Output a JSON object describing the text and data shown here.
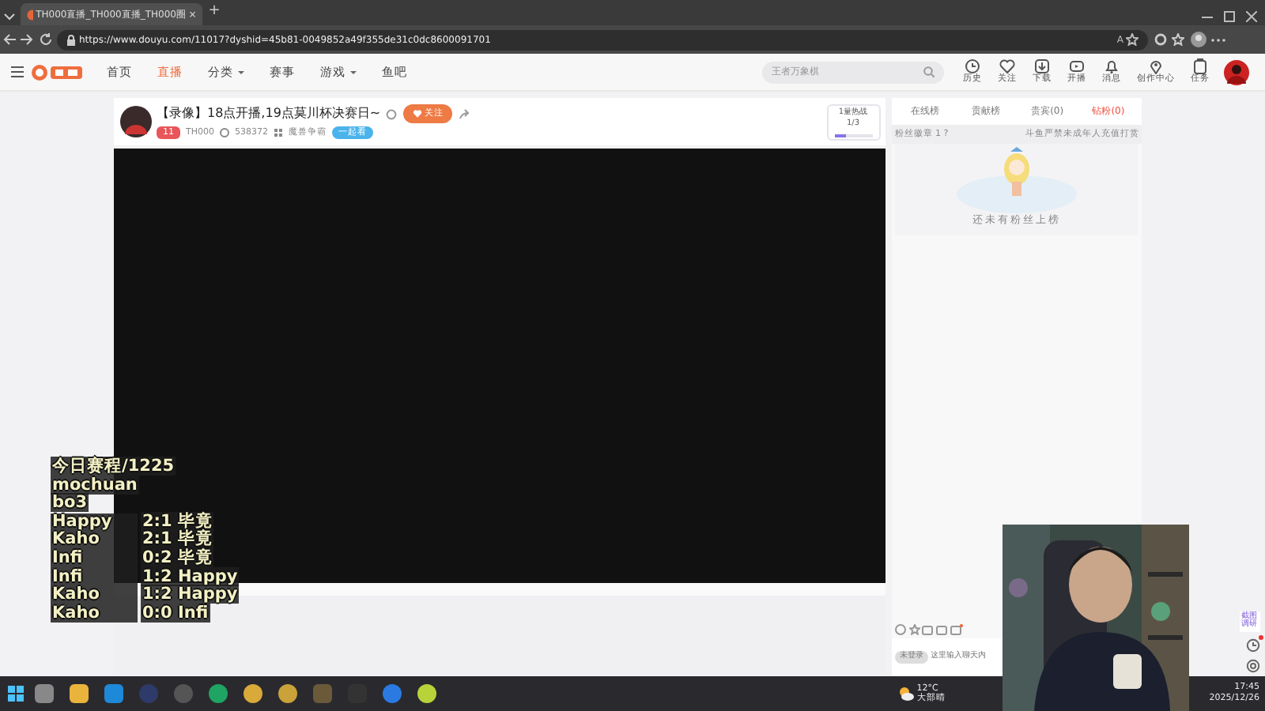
{
  "browser": {
    "tab": {
      "title": "TH000直播_TH000直播_TH000圈",
      "close": "×"
    },
    "new_tab": "+",
    "url": "https://www.douyu.com/11017?dyshid=45b81-0049852a49f355de31c0dc8600091701",
    "read_aloud": "A"
  },
  "nav": {
    "items": [
      {
        "label": "首页",
        "selected": false,
        "dropdown": false
      },
      {
        "label": "直播",
        "selected": true,
        "dropdown": false
      },
      {
        "label": "分类",
        "selected": false,
        "dropdown": true
      },
      {
        "label": "赛事",
        "selected": false,
        "dropdown": false
      },
      {
        "label": "游戏",
        "selected": false,
        "dropdown": true
      },
      {
        "label": "鱼吧",
        "selected": false,
        "dropdown": false
      }
    ],
    "search": {
      "placeholder": "王者万象棋"
    },
    "actions": [
      {
        "kind": "history",
        "label": "历史"
      },
      {
        "kind": "heart",
        "label": "关注"
      },
      {
        "kind": "download",
        "label": "下载"
      },
      {
        "kind": "live",
        "label": "开播"
      },
      {
        "kind": "bell",
        "label": "消息"
      },
      {
        "kind": "pin",
        "label": "创作中心"
      },
      {
        "kind": "task",
        "label": "任务"
      }
    ]
  },
  "stream": {
    "title": "【录像】18点开播,19点莫川杯决赛日~",
    "follow": "关注",
    "level": "11",
    "streamer": "TH000",
    "popularity": "538372",
    "category": "魔兽争霸",
    "tag": "一起看",
    "hot": {
      "label": "1量热战",
      "count": "1/3",
      "level": 0.33
    }
  },
  "chat": {
    "tabs": [
      {
        "label": "在线榜",
        "selected": false
      },
      {
        "label": "贡献榜",
        "selected": false
      },
      {
        "label": "贵宾(0)",
        "selected": false
      },
      {
        "label": "钻粉(0)",
        "selected": true
      }
    ],
    "badge_label": "粉丝徽章",
    "badge_count": "1",
    "help": "?",
    "notice": "斗鱼严禁未成年人充值打赏",
    "empty": "还未有粉丝上榜",
    "input_placeholder": "这里输入聊天内",
    "login": "未登录"
  },
  "overlay": [
    {
      "left": "今日赛程/1225"
    },
    {
      "left": "mochuan"
    },
    {
      "left": "bo3"
    },
    {
      "left": "Happy",
      "right": "2:1 毕竟"
    },
    {
      "left": "Kaho",
      "right": "2:1 毕竟"
    },
    {
      "left": "Infi",
      "right": "0:2 毕竟"
    },
    {
      "left": "Infi",
      "right": "1:2 Happy"
    },
    {
      "left": "Kaho",
      "right": "1:2 Happy"
    },
    {
      "left": "Kaho",
      "right": "0:0 Infi"
    }
  ],
  "side_tools": {
    "label": "截图调研",
    "history_unread": true
  },
  "taskbar": {
    "weather": {
      "temp": "12°C",
      "desc": "大部晴"
    },
    "time": "17:45",
    "date": "2025/12/26"
  }
}
